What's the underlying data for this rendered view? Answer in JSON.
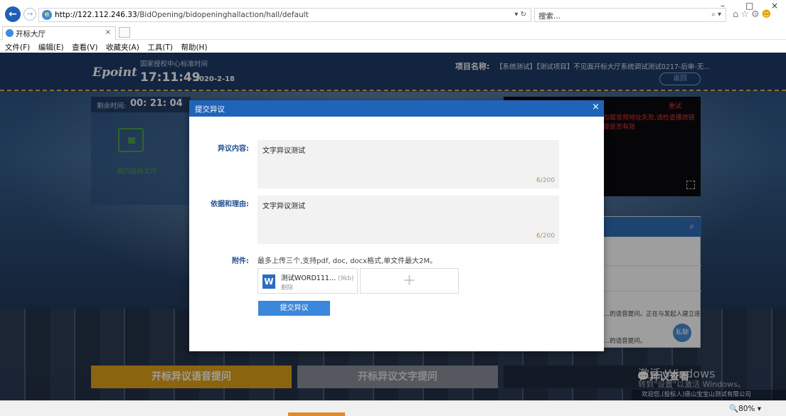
{
  "browser": {
    "url_host": "http://122.112.246.33",
    "url_path": "/BidOpening/bidopeninghallaction/hall/default",
    "url_controls": "▾ ↻",
    "search_placeholder": "搜索...",
    "search_icon": "⌕ ▾",
    "tab_title": "开标大厅",
    "tab_close": "×",
    "window_min": "–",
    "window_max": "□",
    "window_close": "×",
    "toolbar_icons": [
      "home-icon",
      "favorites-icon",
      "settings-icon",
      "feedback-smiley-icon"
    ],
    "menu": [
      "文件(F)",
      "编辑(E)",
      "查看(V)",
      "收藏夹(A)",
      "工具(T)",
      "帮助(H)"
    ],
    "zoom": "🔍80%  ▾"
  },
  "header": {
    "logo": "Epoint",
    "clock_label": "国家授权中心标准时间",
    "clock_time": "17:11:49",
    "clock_date": "2020-2-18",
    "project_label": "项目名称:",
    "project_value": "【系统测试】【测试项目】不见面开标大厅系统调试测试0217-后审-无...",
    "back_label": "返回"
  },
  "left": {
    "remaining_label": "剩余时间:",
    "remaining_value": "00: 21: 04",
    "folder_label": "我的投标文件"
  },
  "video": {
    "error_text": "加载音频地址失败,请检查播放链接是否有效",
    "error_text_short": "重试"
  },
  "chat": {
    "messages": [
      "...的语音提问。正在与发起人建立连",
      "...的语音提问。"
    ],
    "dm_label": "私聊"
  },
  "bottom": {
    "voice_btn": "开标异议语音提问",
    "text_btn": "开标异议文字提问",
    "view_btn": "💬异议查看"
  },
  "watermark": {
    "line1": "激活 Windows",
    "line2": "转到\"设置\"以激活 Windows。",
    "welcome": "欢迎您,(投标人)唐山宝宝山测试有限公司"
  },
  "modal": {
    "title": "提交异议",
    "close": "×",
    "content_label": "异议内容:",
    "content_value": "文字异议测试",
    "content_count_cur": "6",
    "content_count_max": "/200",
    "reason_label": "依据和理由:",
    "reason_value": "文字异议测试",
    "reason_count_cur": "6",
    "reason_count_max": "/200",
    "attach_label": "附件:",
    "attach_hint": "最多上传三个,支持pdf, doc, docx格式,单文件最大2M。",
    "file_name": "测试WORD111...",
    "file_size": "(9kb)",
    "file_delete": "删除",
    "file_type": "W",
    "add_symbol": "+",
    "submit_label": "提交异议"
  }
}
